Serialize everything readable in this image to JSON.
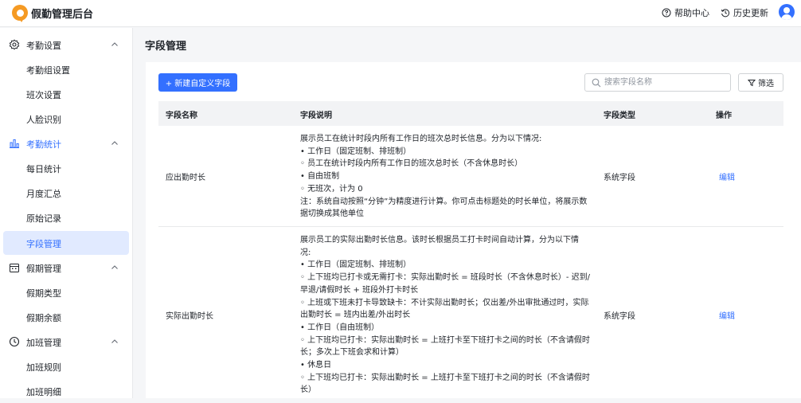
{
  "app": {
    "title": "假勤管理后台"
  },
  "header": {
    "help_label": "帮助中心",
    "history_label": "历史更新"
  },
  "sidebar": {
    "groups": [
      {
        "label": "考勤设置",
        "icon": "gear-icon",
        "items": [
          "考勤组设置",
          "班次设置",
          "人脸识别"
        ]
      },
      {
        "label": "考勤统计",
        "icon": "bar-chart-icon",
        "items": [
          "每日统计",
          "月度汇总",
          "原始记录",
          "字段管理"
        ]
      },
      {
        "label": "假期管理",
        "icon": "calendar-icon",
        "items": [
          "假期类型",
          "假期余额"
        ]
      },
      {
        "label": "加班管理",
        "icon": "clock-icon",
        "items": [
          "加班规则",
          "加班明细"
        ]
      }
    ],
    "active_item": "字段管理"
  },
  "main": {
    "title": "字段管理",
    "add_button": "+ 新建自定义字段",
    "search_placeholder": "搜索字段名称",
    "filter_button": "筛选"
  },
  "table": {
    "headers": [
      "字段名称",
      "字段说明",
      "字段类型",
      "操作"
    ],
    "rows": [
      {
        "name": "应出勤时长",
        "description": [
          "展示员工在统计时段内所有工作日的班次总时长信息。分为以下情况:",
          "• 工作日（固定班制、排班制）",
          "  ◦ 员工在统计时段内所有工作日的班次总时长（不含休息时长）",
          "• 自由班制",
          "  ◦ 无班次，计为 0",
          "注：系统自动按照“分钟”为精度进行计算。你可点击标题处的时长单位，将展示数",
          "据切换成其他单位"
        ],
        "type": "系统字段",
        "action": "编辑"
      },
      {
        "name": "实际出勤时长",
        "description": [
          "展示员工的实际出勤时长信息。该时长根据员工打卡时间自动计算，分为以下情",
          "况:",
          "• 工作日（固定班制、排班制）",
          "  ◦ 上下班均已打卡或无需打卡：实际出勤时长 = 班段时长（不含休息时长）- 迟到/",
          "早退/请假时长 + 班段外打卡时长",
          "  ◦ 上班或下班未打卡导致缺卡：不计实际出勤时长；仅出差/外出审批通过时，实际",
          "出勤时长 = 班内出差/外出时长",
          "• 工作日（自由班制）",
          "  ◦ 上下班均已打卡：实际出勤时长 = 上班打卡至下班打卡之间的时长（不含请假时",
          "长；多次上下班会求和计算）",
          "• 休息日",
          "  ◦ 上下班均已打卡：实际出勤时长 = 上班打卡至下班打卡之间的时长（不含请假时",
          "长）"
        ],
        "type": "系统字段",
        "action": "编辑"
      }
    ]
  },
  "colors": {
    "accent": "#3370ff",
    "active_bg": "#e1eaff",
    "logo": "#f59a23"
  }
}
